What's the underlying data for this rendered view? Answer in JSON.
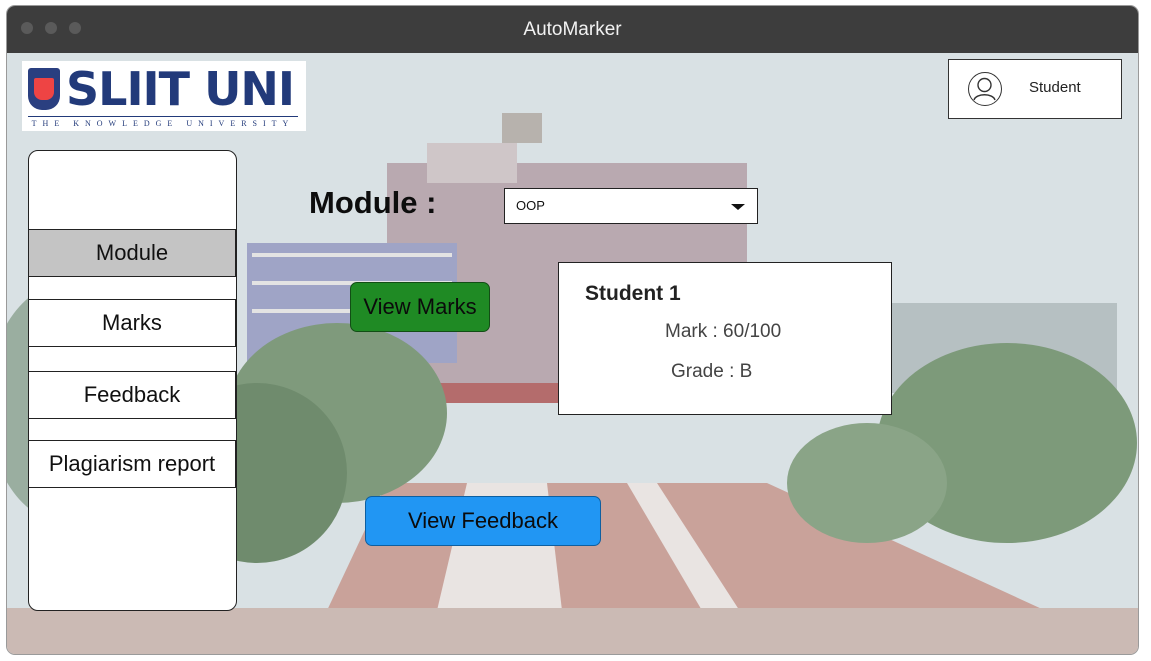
{
  "window": {
    "title": "AutoMarker"
  },
  "logo": {
    "brand": "SLIIT UNI",
    "tagline": "THE KNOWLEDGE UNIVERSITY"
  },
  "user": {
    "label": "Student",
    "icon": "user-icon"
  },
  "sidebar": {
    "items": [
      {
        "label": "Module",
        "active": true
      },
      {
        "label": "Marks",
        "active": false
      },
      {
        "label": "Feedback",
        "active": false
      },
      {
        "label": "Plagiarism report",
        "active": false
      }
    ]
  },
  "module": {
    "label": "Module :",
    "selected": "OOP"
  },
  "actions": {
    "view_marks": "View Marks",
    "view_feedback": "View Feedback"
  },
  "result": {
    "student": "Student 1",
    "mark": "Mark : 60/100",
    "grade": "Grade : B"
  },
  "colors": {
    "titlebar": "#3d3d3d",
    "view_marks": "#1f8a24",
    "view_feedback": "#2196f3",
    "active_nav": "#c4c4c4"
  }
}
